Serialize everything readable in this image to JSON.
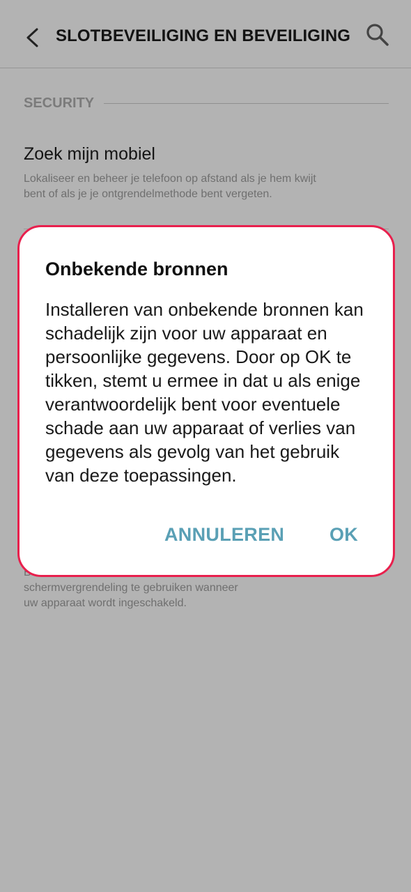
{
  "header": {
    "title": "SLOTBEVEILIGING EN BEVEILIGING",
    "back_icon": "chevron-left-icon",
    "search_icon": "search-icon"
  },
  "section": {
    "label": "SECURITY"
  },
  "find_my_mobile": {
    "title": "Zoek mijn mobiel",
    "description": "Lokaliseer en beheer je telefoon op afstand als je hem kwijt bent of als je je ontgrendelmethode bent vergeten."
  },
  "secure_startup": {
    "description_visible": "Bes... schermvergrendeling te gebruiken wanneer uw apparaat wordt ingeschakeld.",
    "line1": "Be",
    "line2": "schermvergrendeling te gebruiken wanneer",
    "line3": "uw apparaat wordt ingeschakeld."
  },
  "dialog": {
    "title": "Onbekende bronnen",
    "message": "Installeren van onbekende bronnen kan schadelijk zijn voor uw apparaat en persoonlijke gegevens. Door op OK te tikken, stemt u ermee in dat u als enige verantwoordelijk bent voor eventuele schade aan uw apparaat of verlies van gegevens als gevolg van het gebruik van deze toepassingen.",
    "cancel_label": "ANNULEREN",
    "ok_label": "OK"
  },
  "colors": {
    "background_dimmed": "#b3b3b3",
    "dialog_border": "#e8204d",
    "button_text": "#5aa0b5"
  }
}
